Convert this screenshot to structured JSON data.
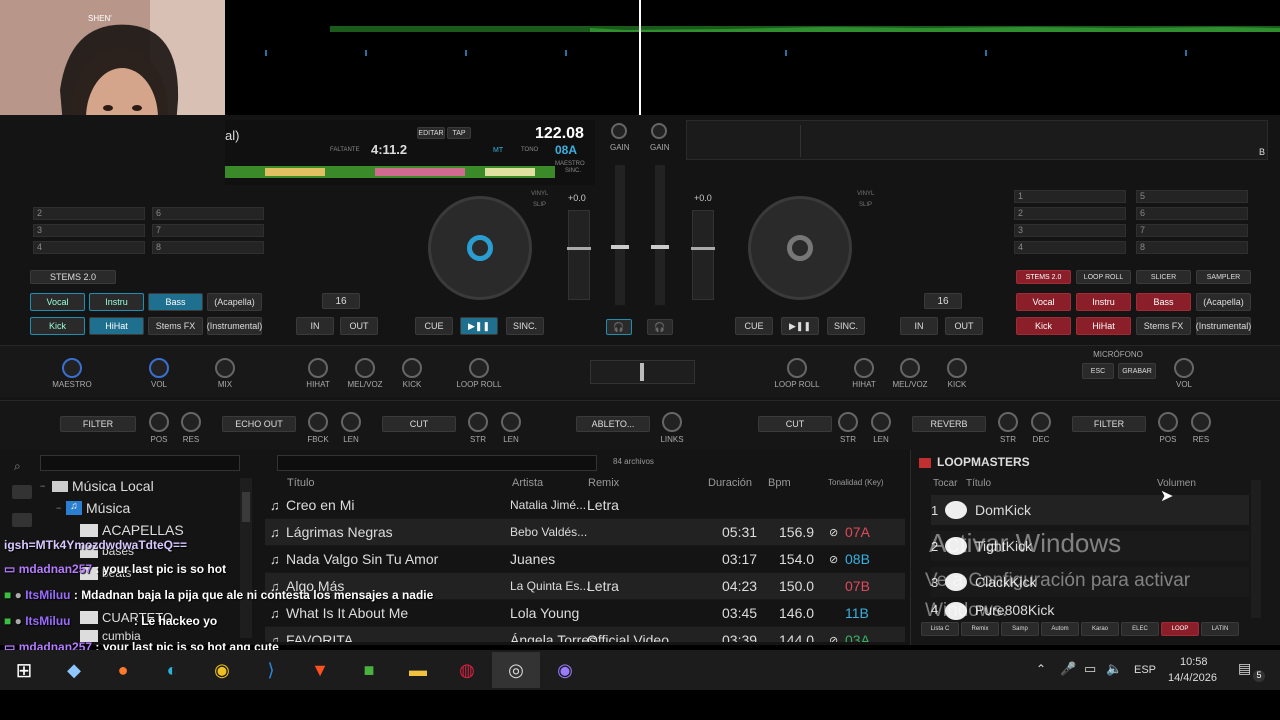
{
  "deck_left": {
    "title_fragment": "al)",
    "remaining_label": "FALTANTE",
    "remaining_time": "4:11.2",
    "edit_label": "EDITAR",
    "tap_label": "TAP",
    "bpm": "122.08",
    "key": "08A",
    "key_mode": "MT",
    "tone_label": "TONO",
    "master_label": "MAESTRO",
    "sync_label": "SINC.",
    "pitch": "+0.0",
    "vinyl_label": "VINYL",
    "slip_label": "SLIP",
    "cue_label": "CUE",
    "sync_button": "SINC.",
    "loop_size": "16",
    "in_label": "IN",
    "out_label": "OUT",
    "stems_label": "STEMS 2.0",
    "pad_slots": [
      "2",
      "3",
      "4",
      "6",
      "7",
      "8"
    ],
    "stem_buttons_row1": [
      "Vocal",
      "Instru",
      "Bass",
      "(Acapella)"
    ],
    "stem_buttons_row2": [
      "Kick",
      "HiHat",
      "Stems FX",
      "(Instrumental)"
    ],
    "fx_knobs": [
      "MAESTRO",
      "VOL",
      "MIX"
    ],
    "deck_knobs": [
      "HIHAT",
      "MEL/VOZ",
      "KICK",
      "LOOP ROLL"
    ],
    "filter_label": "FILTER",
    "pos_label": "POS",
    "res_label": "RES",
    "echo_label": "ECHO OUT",
    "fbck_label": "FBCK",
    "len_label": "LEN",
    "cut_label": "CUT",
    "str_label": "STR",
    "len2_label": "LEN"
  },
  "mixer": {
    "gain_left": "GAIN",
    "gain_right": "GAIN",
    "ableton_label": "ABLETO...",
    "links_label": "LINKS"
  },
  "deck_right": {
    "pitch": "+0.0",
    "vinyl_label": "VINYL",
    "slip_label": "SLIP",
    "cue_label": "CUE",
    "sync_button": "SINC.",
    "loop_size": "16",
    "in_label": "IN",
    "out_label": "OUT",
    "side_label": "B",
    "mode_tabs": [
      "STEMS 2.0",
      "LOOP ROLL",
      "SLICER",
      "SAMPLER"
    ],
    "pad_slots": [
      "1",
      "2",
      "3",
      "4",
      "5",
      "6",
      "7",
      "8"
    ],
    "stem_buttons_row1": [
      "Vocal",
      "Instru",
      "Bass",
      "(Acapella)"
    ],
    "stem_buttons_row2": [
      "Kick",
      "HiHat",
      "Stems FX",
      "(Instrumental)"
    ],
    "deck_knobs": [
      "LOOP ROLL",
      "HIHAT",
      "MEL/VOZ",
      "KICK"
    ],
    "mic_label": "MICRÓFONO",
    "mic_buttons": [
      "ESC",
      "GRABAR"
    ],
    "vol_label": "VOL",
    "cut_label": "CUT",
    "str_label": "STR",
    "len_label": "LEN",
    "reverb_label": "REVERB",
    "dec_label": "DEC",
    "filter_label": "FILTER",
    "pos_label": "POS",
    "res_label": "RES"
  },
  "browser": {
    "tree": [
      "Música Local",
      "Música",
      "ACAPELLAS",
      "bases",
      "beats",
      "CUARTETO",
      "cumbia"
    ],
    "file_count": "84 archivos",
    "columns": [
      "Título",
      "Artista",
      "Remix",
      "Duración",
      "Bpm",
      "Tonalidad (Key)"
    ],
    "rows": [
      {
        "title": "Creo en Mi",
        "artist": "Natalia Jimé...",
        "remix": "Letra",
        "duration": "",
        "bpm": "",
        "key": ""
      },
      {
        "title": "Lágrimas Negras",
        "artist": "Bebo Valdés...",
        "remix": "",
        "duration": "05:31",
        "bpm": "156.9",
        "key": "07A"
      },
      {
        "title": "Nada Valgo Sin Tu Amor",
        "artist": "Juanes",
        "remix": "",
        "duration": "03:17",
        "bpm": "154.0",
        "key": "08B"
      },
      {
        "title": "Algo Más",
        "artist": "La Quinta Es...",
        "remix": "Letra",
        "duration": "04:23",
        "bpm": "150.0",
        "key": "07B"
      },
      {
        "title": "What Is It About Me",
        "artist": "Lola Young",
        "remix": "",
        "duration": "03:45",
        "bpm": "146.0",
        "key": "11B"
      },
      {
        "title": "FAVORITA",
        "artist": "Ángela Torres",
        "remix": "Official Video",
        "duration": "03:39",
        "bpm": "144.0",
        "key": "03A"
      }
    ]
  },
  "loopmasters": {
    "title": "LOOPMASTERS",
    "columns": [
      "Tocar",
      "Título",
      "Volumen"
    ],
    "items": [
      {
        "num": "1",
        "name": "DomKick"
      },
      {
        "num": "2",
        "name": "TightKick"
      },
      {
        "num": "3",
        "name": "ClackKick"
      },
      {
        "num": "4",
        "name": "Pure808Kick"
      }
    ],
    "tabs": [
      "Lista C",
      "Remix",
      "Samp",
      "Autom",
      "Karao",
      "ELEC",
      "LOOP",
      "LATIN"
    ],
    "activate_title": "Activar Windows",
    "activate_sub": "Ve a Configuración para activar Windows."
  },
  "webcam": {
    "overlay_text": "SHEN'"
  },
  "chat": {
    "lines": [
      {
        "user": "",
        "text": "igsh=MTk4YmozdwdwaTdteQ=="
      },
      {
        "user": "mdadnan257",
        "text": ": your last pic is so hot"
      },
      {
        "user": "ItsMiluu",
        "text": ": Mdadnan baja la pija que ale ni contesta los mensajes a nadie"
      },
      {
        "user": "ItsMiluu",
        "text": ": Le hackeo yo"
      },
      {
        "user": "mdadnan257",
        "text": ": your last pic is so hot ang cute"
      }
    ]
  },
  "taskbar": {
    "language": "ESP",
    "time": "10:58",
    "date": "14/4/2026",
    "notifications": "5"
  }
}
